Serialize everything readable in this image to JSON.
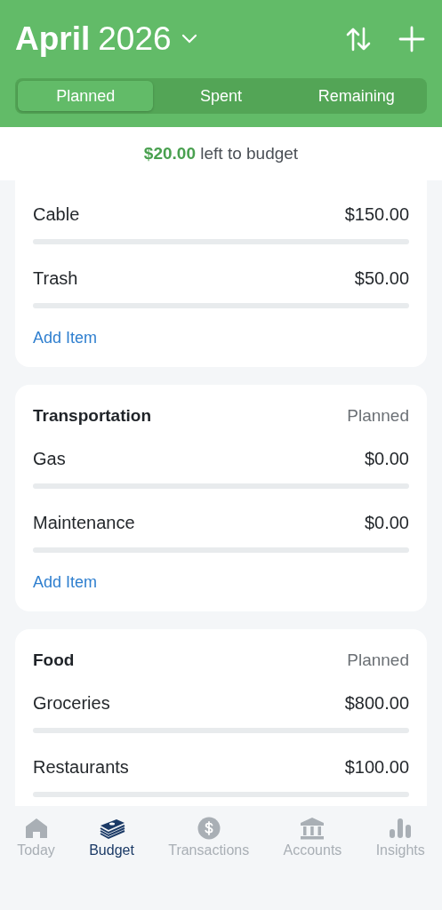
{
  "header": {
    "month": "April",
    "year": "2026"
  },
  "tabs": [
    {
      "label": "Planned",
      "selected": true
    },
    {
      "label": "Spent",
      "selected": false
    },
    {
      "label": "Remaining",
      "selected": false
    }
  ],
  "summary": {
    "amount": "$20.00",
    "text": "left to budget"
  },
  "groups": [
    {
      "items": [
        {
          "name": "Cable",
          "amount": "$150.00"
        },
        {
          "name": "Trash",
          "amount": "$50.00"
        }
      ],
      "add_label": "Add Item"
    },
    {
      "title": "Transportation",
      "column": "Planned",
      "items": [
        {
          "name": "Gas",
          "amount": "$0.00"
        },
        {
          "name": "Maintenance",
          "amount": "$0.00"
        }
      ],
      "add_label": "Add Item"
    },
    {
      "title": "Food",
      "column": "Planned",
      "items": [
        {
          "name": "Groceries",
          "amount": "$800.00"
        },
        {
          "name": "Restaurants",
          "amount": "$100.00"
        }
      ]
    }
  ],
  "nav": [
    {
      "label": "Today",
      "kind": "home",
      "selected": false
    },
    {
      "label": "Budget",
      "kind": "budget",
      "selected": true
    },
    {
      "label": "Transactions",
      "kind": "dollar",
      "selected": false
    },
    {
      "label": "Accounts",
      "kind": "bank",
      "selected": false
    },
    {
      "label": "Insights",
      "kind": "chart",
      "selected": false
    }
  ]
}
